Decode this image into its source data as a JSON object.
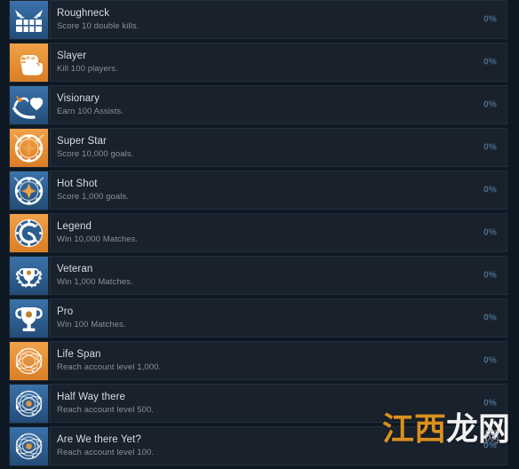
{
  "theme": {
    "page_bg": "#0e1822",
    "row_bg": "#18212c",
    "row_border": "#22303f",
    "title_color": "#d7dde3",
    "desc_color": "#8a9199",
    "percent_color": "#4a6d8e",
    "icon_blue": "#2a598c",
    "icon_orange": "#e08b34"
  },
  "achievements": [
    {
      "icon_name": "roughneck-mask-icon",
      "icon_bg": "blue",
      "icon_glyph": "mask",
      "title": "Roughneck",
      "description": "Score 10 double kills.",
      "percent": "0%"
    },
    {
      "icon_name": "slayer-fist-icon",
      "icon_bg": "orange",
      "icon_glyph": "fist",
      "title": "Slayer",
      "description": "Kill 100 players.",
      "percent": "0%"
    },
    {
      "icon_name": "visionary-heart-icon",
      "icon_bg": "blue",
      "icon_glyph": "heart",
      "title": "Visionary",
      "description": "Earn 100 Assists.",
      "percent": "0%"
    },
    {
      "icon_name": "super-star-emblem-icon",
      "icon_bg": "orange",
      "icon_glyph": "star-emblem",
      "title": "Super Star",
      "description": "Score 10,000 goals.",
      "percent": "0%"
    },
    {
      "icon_name": "hot-shot-emblem-icon",
      "icon_bg": "blue",
      "icon_glyph": "star-emblem",
      "title": "Hot Shot",
      "description": "Score 1,000 goals.",
      "percent": "0%"
    },
    {
      "icon_name": "legend-crest-icon",
      "icon_bg": "orange",
      "icon_glyph": "crest",
      "title": "Legend",
      "description": "Win 10,000 Matches.",
      "percent": "0%"
    },
    {
      "icon_name": "veteran-laurel-trophy-icon",
      "icon_bg": "blue",
      "icon_glyph": "laurel-trophy",
      "title": "Veteran",
      "description": "Win 1,000 Matches.",
      "percent": "0%"
    },
    {
      "icon_name": "pro-trophy-icon",
      "icon_bg": "blue",
      "icon_glyph": "trophy",
      "title": "Pro",
      "description": "Win 100 Matches.",
      "percent": "0%"
    },
    {
      "icon_name": "life-span-orbit-icon",
      "icon_bg": "orange",
      "icon_glyph": "orbit",
      "title": "Life Span",
      "description": "Reach account level 1,000.",
      "percent": "0%"
    },
    {
      "icon_name": "half-way-there-orbit-icon",
      "icon_bg": "blue",
      "icon_glyph": "orbit",
      "title": "Half Way there",
      "description": "Reach account level 500.",
      "percent": "0%"
    },
    {
      "icon_name": "are-we-there-yet-orbit-icon",
      "icon_bg": "blue",
      "icon_glyph": "orbit",
      "title": "Are We there Yet?",
      "description": "Reach account level 100.",
      "percent": "0%"
    }
  ],
  "watermark": {
    "part_a": "江西",
    "part_b": "龙网",
    "small": "网"
  }
}
